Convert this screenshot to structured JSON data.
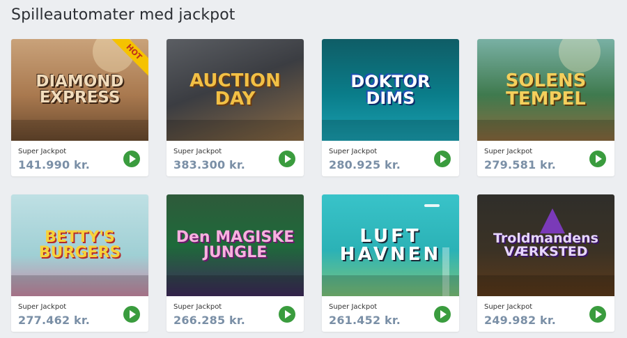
{
  "page": {
    "title": "Spilleautomater med jackpot"
  },
  "colors": {
    "play_button": "#3a9c3e",
    "jackpot_value": "#7a8fa6",
    "hot_badge": "#f5c200"
  },
  "games": [
    {
      "title": "DIAMOND EXPRESS",
      "badge": "HOT",
      "jackpot_label": "Super Jackpot",
      "jackpot_value": "141.990 kr."
    },
    {
      "title": "AUCTION DAY",
      "jackpot_label": "Super Jackpot",
      "jackpot_value": "383.300 kr."
    },
    {
      "title": "DOKTOR DIMS",
      "jackpot_label": "Super Jackpot",
      "jackpot_value": "280.925 kr."
    },
    {
      "title": "SOLENS TEMPEL",
      "jackpot_label": "Super Jackpot",
      "jackpot_value": "279.581 kr."
    },
    {
      "title": "BETTY'S BURGERS",
      "jackpot_label": "Super Jackpot",
      "jackpot_value": "277.462 kr."
    },
    {
      "title": "Den MAGISKE JUNGLE",
      "jackpot_label": "Super Jackpot",
      "jackpot_value": "266.285 kr."
    },
    {
      "title": "LUFT HAVNEN",
      "jackpot_label": "Super Jackpot",
      "jackpot_value": "261.452 kr."
    },
    {
      "title": "Troldmandens VÆRKSTED",
      "jackpot_label": "Super Jackpot",
      "jackpot_value": "249.982 kr."
    }
  ]
}
